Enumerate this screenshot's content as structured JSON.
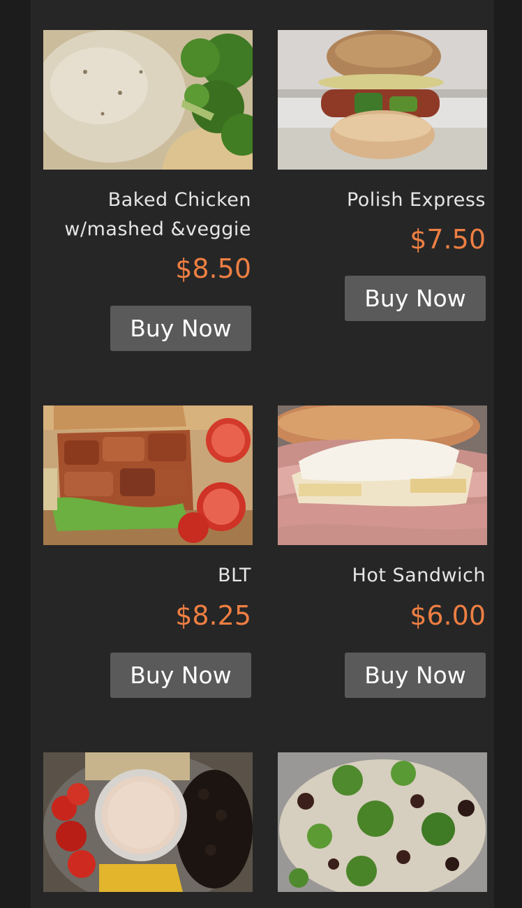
{
  "colors": {
    "page_background": "#1c1c1c",
    "panel_background": "#262626",
    "price": "#ee7f43",
    "button_background": "#5a5a5a",
    "button_text": "#ffffff",
    "name_text": "#e6e6e6"
  },
  "products": [
    {
      "name": "Baked Chicken\nw/mashed &veggie",
      "price": "$8.50",
      "button_label": "Buy Now",
      "image": "baked-chicken-photo"
    },
    {
      "name": "Polish Express",
      "price": "$7.50",
      "button_label": "Buy Now",
      "image": "polish-sausage-sandwich-photo"
    },
    {
      "name": "BLT",
      "price": "$8.25",
      "button_label": "Buy Now",
      "image": "blt-sandwich-photo"
    },
    {
      "name": "Hot Sandwich",
      "price": "$6.00",
      "button_label": "Buy Now",
      "image": "hot-ham-sandwich-photo"
    },
    {
      "image": "salad-bowl-photo"
    },
    {
      "image": "pasta-salad-photo"
    }
  ]
}
